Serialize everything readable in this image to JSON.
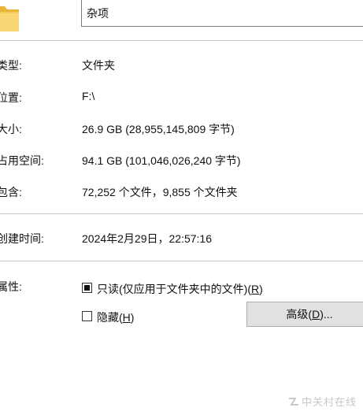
{
  "header": {
    "folder_name": "杂项"
  },
  "general": {
    "type_label": "类型:",
    "type_value": "文件夹",
    "location_label": "位置:",
    "location_value": "F:\\",
    "size_label": "大小:",
    "size_value": "26.9 GB (28,955,145,809 字节)",
    "size_on_disk_label": "占用空间:",
    "size_on_disk_value": "94.1 GB (101,046,026,240 字节)",
    "contains_label": "包含:",
    "contains_value": "72,252 个文件，9,855 个文件夹"
  },
  "created": {
    "label": "创建时间:",
    "value": "2024年2月29日，22:57:16"
  },
  "attributes": {
    "label": "属性:",
    "readonly_text": "只读(仅应用于文件夹中的文件)(",
    "readonly_key": "R",
    "readonly_close": ")",
    "readonly_state": "indeterminate",
    "hidden_text": "隐藏(",
    "hidden_key": "H",
    "hidden_close": ")",
    "hidden_state": "unchecked",
    "advanced_text": "高级(",
    "advanced_key": "D",
    "advanced_close": ")..."
  },
  "watermark": {
    "text": "中关村在线"
  },
  "icons": {
    "folder": "folder-icon",
    "watermark_logo": "zol-logo-icon"
  }
}
